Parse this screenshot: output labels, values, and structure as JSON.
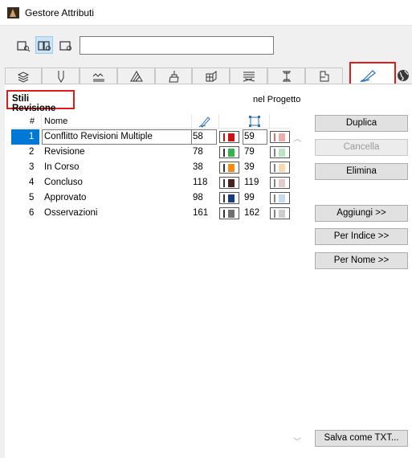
{
  "window": {
    "title": "Gestore Attributi"
  },
  "search": {
    "value": "",
    "placeholder": ""
  },
  "toolbar": {
    "buttons": [
      "view-mode-list-icon",
      "view-mode-compare-icon",
      "view-mode-single-icon"
    ],
    "active_index": 1
  },
  "tabs": [
    "layers-icon",
    "pens-icon",
    "line-types-icon",
    "fill-types-icon",
    "surfaces-icon",
    "building-materials-icon",
    "composites-icon",
    "profiles-icon",
    "zones-icon",
    "revision-styles-icon",
    "globe-icon"
  ],
  "selected_tab": "revision-styles-icon",
  "panel": {
    "title": "Stili Revisione",
    "scope": "nel Progetto"
  },
  "table": {
    "headers": {
      "index": "#",
      "name": "Nome"
    },
    "rows": [
      {
        "index": "1",
        "name": "Conflitto Revisioni Multiple",
        "pen1": "58",
        "color1": "#cc1111",
        "pen2": "59",
        "color2": "#cc1111",
        "selected": true
      },
      {
        "index": "2",
        "name": "Revisione",
        "pen1": "78",
        "color1": "#33b34d",
        "pen2": "79",
        "color2": "#33b34d",
        "selected": false
      },
      {
        "index": "3",
        "name": "In Corso",
        "pen1": "38",
        "color1": "#f08c1a",
        "pen2": "39",
        "color2": "#f08c1a",
        "selected": false
      },
      {
        "index": "4",
        "name": "Concluso",
        "pen1": "118",
        "color1": "#4d2020",
        "pen2": "119",
        "color2": "#b36666",
        "selected": false
      },
      {
        "index": "5",
        "name": "Approvato",
        "pen1": "98",
        "color1": "#1a3a80",
        "pen2": "99",
        "color2": "#5599dd",
        "selected": false
      },
      {
        "index": "6",
        "name": "Osservazioni",
        "pen1": "161",
        "color1": "#707070",
        "pen2": "162",
        "color2": "#707070",
        "selected": false
      }
    ]
  },
  "buttons": {
    "duplicate": "Duplica",
    "delete": "Cancella",
    "remove": "Elimina",
    "add": "Aggiungi >>",
    "by_index": "Per Indice >>",
    "by_name": "Per Nome >>",
    "save_txt": "Salva come TXT..."
  },
  "colors": {
    "highlight_red": "#e01b1b",
    "selection_blue": "#0078d7"
  }
}
